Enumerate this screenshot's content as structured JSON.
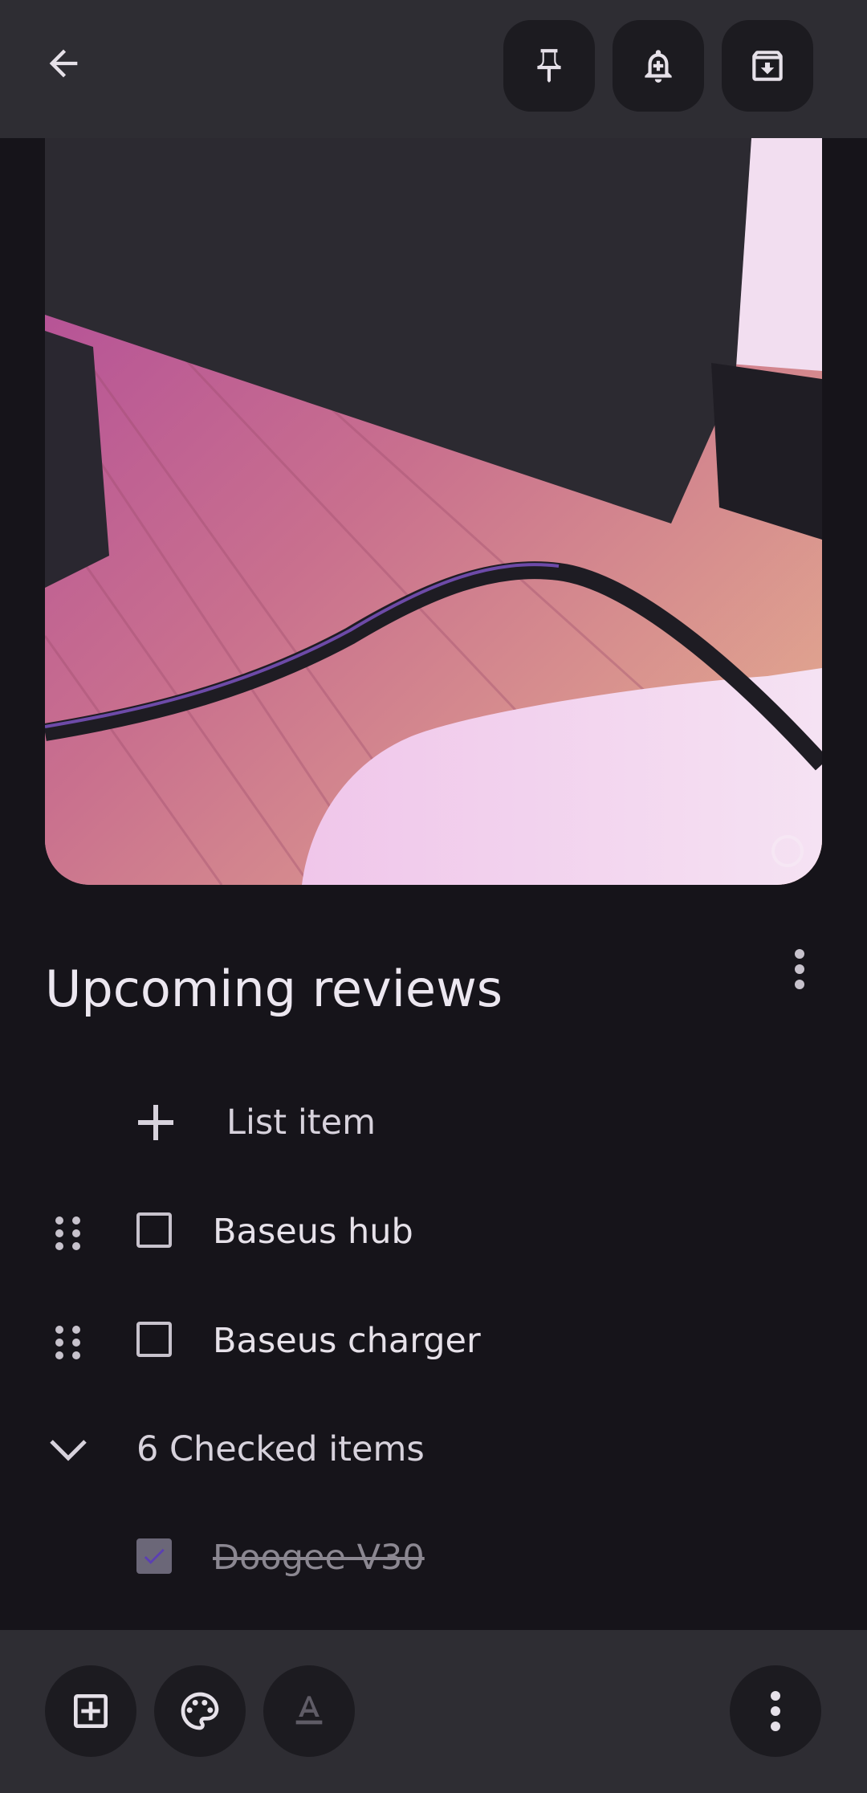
{
  "topbar": {
    "back_icon": "arrow-back-icon",
    "actions": [
      {
        "name": "pin",
        "icon": "pin-icon"
      },
      {
        "name": "reminder",
        "icon": "bell-plus-icon"
      },
      {
        "name": "archive",
        "icon": "archive-icon"
      }
    ]
  },
  "photo": {
    "overlay_icon": "rotate-icon"
  },
  "note": {
    "title": "Upcoming reviews",
    "add_item_label": "List item",
    "items": [
      {
        "label": "Baseus hub",
        "checked": false
      },
      {
        "label": "Baseus charger",
        "checked": false
      }
    ],
    "checked_header": "6 Checked items",
    "checked_items": [
      {
        "label": "Doogee V30",
        "checked": true
      }
    ]
  },
  "bottombar": {
    "buttons": [
      "add-box-icon",
      "palette-icon",
      "text-format-icon",
      "more-vert-icon"
    ]
  },
  "colors": {
    "background": "#16141a",
    "bars": "#2e2d33",
    "button": "#1c1b20",
    "checkmark": "#5b3fb3"
  }
}
